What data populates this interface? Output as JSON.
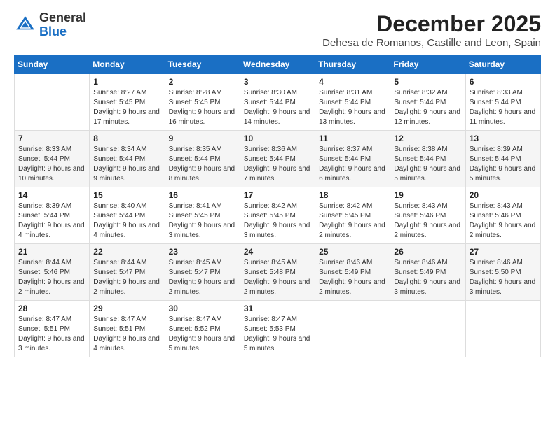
{
  "header": {
    "logo_line1": "General",
    "logo_line2": "Blue",
    "month_title": "December 2025",
    "location": "Dehesa de Romanos, Castille and Leon, Spain"
  },
  "weekdays": [
    "Sunday",
    "Monday",
    "Tuesday",
    "Wednesday",
    "Thursday",
    "Friday",
    "Saturday"
  ],
  "weeks": [
    [
      {
        "day": "",
        "info": ""
      },
      {
        "day": "1",
        "info": "Sunrise: 8:27 AM\nSunset: 5:45 PM\nDaylight: 9 hours\nand 17 minutes."
      },
      {
        "day": "2",
        "info": "Sunrise: 8:28 AM\nSunset: 5:45 PM\nDaylight: 9 hours\nand 16 minutes."
      },
      {
        "day": "3",
        "info": "Sunrise: 8:30 AM\nSunset: 5:44 PM\nDaylight: 9 hours\nand 14 minutes."
      },
      {
        "day": "4",
        "info": "Sunrise: 8:31 AM\nSunset: 5:44 PM\nDaylight: 9 hours\nand 13 minutes."
      },
      {
        "day": "5",
        "info": "Sunrise: 8:32 AM\nSunset: 5:44 PM\nDaylight: 9 hours\nand 12 minutes."
      },
      {
        "day": "6",
        "info": "Sunrise: 8:33 AM\nSunset: 5:44 PM\nDaylight: 9 hours\nand 11 minutes."
      }
    ],
    [
      {
        "day": "7",
        "info": "Sunrise: 8:33 AM\nSunset: 5:44 PM\nDaylight: 9 hours\nand 10 minutes."
      },
      {
        "day": "8",
        "info": "Sunrise: 8:34 AM\nSunset: 5:44 PM\nDaylight: 9 hours\nand 9 minutes."
      },
      {
        "day": "9",
        "info": "Sunrise: 8:35 AM\nSunset: 5:44 PM\nDaylight: 9 hours\nand 8 minutes."
      },
      {
        "day": "10",
        "info": "Sunrise: 8:36 AM\nSunset: 5:44 PM\nDaylight: 9 hours\nand 7 minutes."
      },
      {
        "day": "11",
        "info": "Sunrise: 8:37 AM\nSunset: 5:44 PM\nDaylight: 9 hours\nand 6 minutes."
      },
      {
        "day": "12",
        "info": "Sunrise: 8:38 AM\nSunset: 5:44 PM\nDaylight: 9 hours\nand 5 minutes."
      },
      {
        "day": "13",
        "info": "Sunrise: 8:39 AM\nSunset: 5:44 PM\nDaylight: 9 hours\nand 5 minutes."
      }
    ],
    [
      {
        "day": "14",
        "info": "Sunrise: 8:39 AM\nSunset: 5:44 PM\nDaylight: 9 hours\nand 4 minutes."
      },
      {
        "day": "15",
        "info": "Sunrise: 8:40 AM\nSunset: 5:44 PM\nDaylight: 9 hours\nand 4 minutes."
      },
      {
        "day": "16",
        "info": "Sunrise: 8:41 AM\nSunset: 5:45 PM\nDaylight: 9 hours\nand 3 minutes."
      },
      {
        "day": "17",
        "info": "Sunrise: 8:42 AM\nSunset: 5:45 PM\nDaylight: 9 hours\nand 3 minutes."
      },
      {
        "day": "18",
        "info": "Sunrise: 8:42 AM\nSunset: 5:45 PM\nDaylight: 9 hours\nand 2 minutes."
      },
      {
        "day": "19",
        "info": "Sunrise: 8:43 AM\nSunset: 5:46 PM\nDaylight: 9 hours\nand 2 minutes."
      },
      {
        "day": "20",
        "info": "Sunrise: 8:43 AM\nSunset: 5:46 PM\nDaylight: 9 hours\nand 2 minutes."
      }
    ],
    [
      {
        "day": "21",
        "info": "Sunrise: 8:44 AM\nSunset: 5:46 PM\nDaylight: 9 hours\nand 2 minutes."
      },
      {
        "day": "22",
        "info": "Sunrise: 8:44 AM\nSunset: 5:47 PM\nDaylight: 9 hours\nand 2 minutes."
      },
      {
        "day": "23",
        "info": "Sunrise: 8:45 AM\nSunset: 5:47 PM\nDaylight: 9 hours\nand 2 minutes."
      },
      {
        "day": "24",
        "info": "Sunrise: 8:45 AM\nSunset: 5:48 PM\nDaylight: 9 hours\nand 2 minutes."
      },
      {
        "day": "25",
        "info": "Sunrise: 8:46 AM\nSunset: 5:49 PM\nDaylight: 9 hours\nand 2 minutes."
      },
      {
        "day": "26",
        "info": "Sunrise: 8:46 AM\nSunset: 5:49 PM\nDaylight: 9 hours\nand 3 minutes."
      },
      {
        "day": "27",
        "info": "Sunrise: 8:46 AM\nSunset: 5:50 PM\nDaylight: 9 hours\nand 3 minutes."
      }
    ],
    [
      {
        "day": "28",
        "info": "Sunrise: 8:47 AM\nSunset: 5:51 PM\nDaylight: 9 hours\nand 3 minutes."
      },
      {
        "day": "29",
        "info": "Sunrise: 8:47 AM\nSunset: 5:51 PM\nDaylight: 9 hours\nand 4 minutes."
      },
      {
        "day": "30",
        "info": "Sunrise: 8:47 AM\nSunset: 5:52 PM\nDaylight: 9 hours\nand 5 minutes."
      },
      {
        "day": "31",
        "info": "Sunrise: 8:47 AM\nSunset: 5:53 PM\nDaylight: 9 hours\nand 5 minutes."
      },
      {
        "day": "",
        "info": ""
      },
      {
        "day": "",
        "info": ""
      },
      {
        "day": "",
        "info": ""
      }
    ]
  ]
}
